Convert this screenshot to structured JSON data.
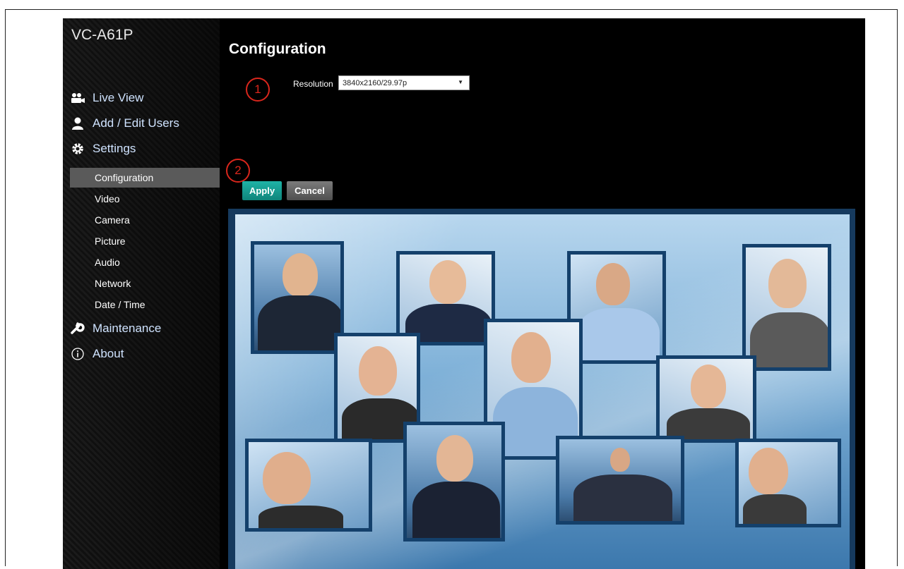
{
  "app": {
    "model": "VC-A61P",
    "page_title": "Configuration"
  },
  "sidebar": {
    "nav": [
      {
        "label": "Live View",
        "icon": "video-camera-icon"
      },
      {
        "label": "Add / Edit Users",
        "icon": "user-icon"
      },
      {
        "label": "Settings",
        "icon": "gear-icon"
      }
    ],
    "settings_items": [
      {
        "label": "Configuration",
        "active": true
      },
      {
        "label": "Video",
        "active": false
      },
      {
        "label": "Camera",
        "active": false
      },
      {
        "label": "Picture",
        "active": false
      },
      {
        "label": "Audio",
        "active": false
      },
      {
        "label": "Network",
        "active": false
      },
      {
        "label": "Date / Time",
        "active": false
      }
    ],
    "maintenance": {
      "label": "Maintenance",
      "icon": "wrench-icon"
    },
    "about": {
      "label": "About",
      "icon": "info-icon"
    }
  },
  "config": {
    "resolution_label": "Resolution",
    "resolution_value": "3840x2160/29.97p"
  },
  "callouts": [
    "1",
    "2"
  ],
  "buttons": {
    "apply": "Apply",
    "cancel": "Cancel"
  },
  "colors": {
    "apply": "#1a9e93",
    "cancel": "#5f5f5f",
    "callout": "#d9261c",
    "nav_text": "#cfe3ff",
    "active_item": "#5a5a5a"
  }
}
